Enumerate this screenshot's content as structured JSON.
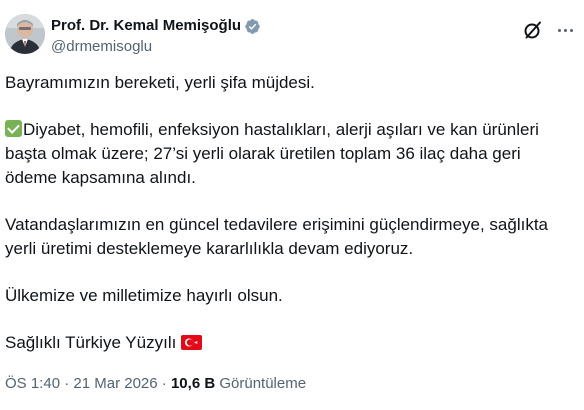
{
  "author": {
    "display_name": "Prof. Dr. Kemal Memişoğlu",
    "handle": "@drmemisoglu",
    "verified": true
  },
  "tweet": {
    "p1": "Bayramımızın bereketi, yerli şifa müjdesi.",
    "p2_line1": "Diyabet, hemofili, enfeksiyon hastalıkları, alerji aşıları ve kan ürünleri",
    "p2_line2": "başta olmak üzere; 27’si yerli olarak üretilen toplam 36 ilaç daha geri",
    "p2_line3": "ödeme kapsamına alındı.",
    "p3_line1": "Vatandaşlarımızın en güncel tedavilere erişimini güçlendirmeye, sağlıkta",
    "p3_line2": "yerli üretimi desteklemeye kararlılıkla devam ediyoruz.",
    "p4": "Ülkemize ve milletimize hayırlı olsun.",
    "p5": "Sağlıklı Türkiye Yüzyılı"
  },
  "meta": {
    "time": "ÖS 1:40",
    "separator": "·",
    "date": "21 Mar 2026",
    "views_count": "10,6 B",
    "views_label": "Görüntüleme"
  },
  "icons": {
    "verified": "verified-badge-icon",
    "grok": "grok-icon",
    "more": "more-horizontal-icon",
    "check": "check-mark-emoji",
    "flag": "turkey-flag-emoji"
  },
  "colors": {
    "text": "#0f1419",
    "secondary": "#536471",
    "verified": "#829aab",
    "check_green": "#77b255",
    "flag_red": "#e30a17"
  }
}
